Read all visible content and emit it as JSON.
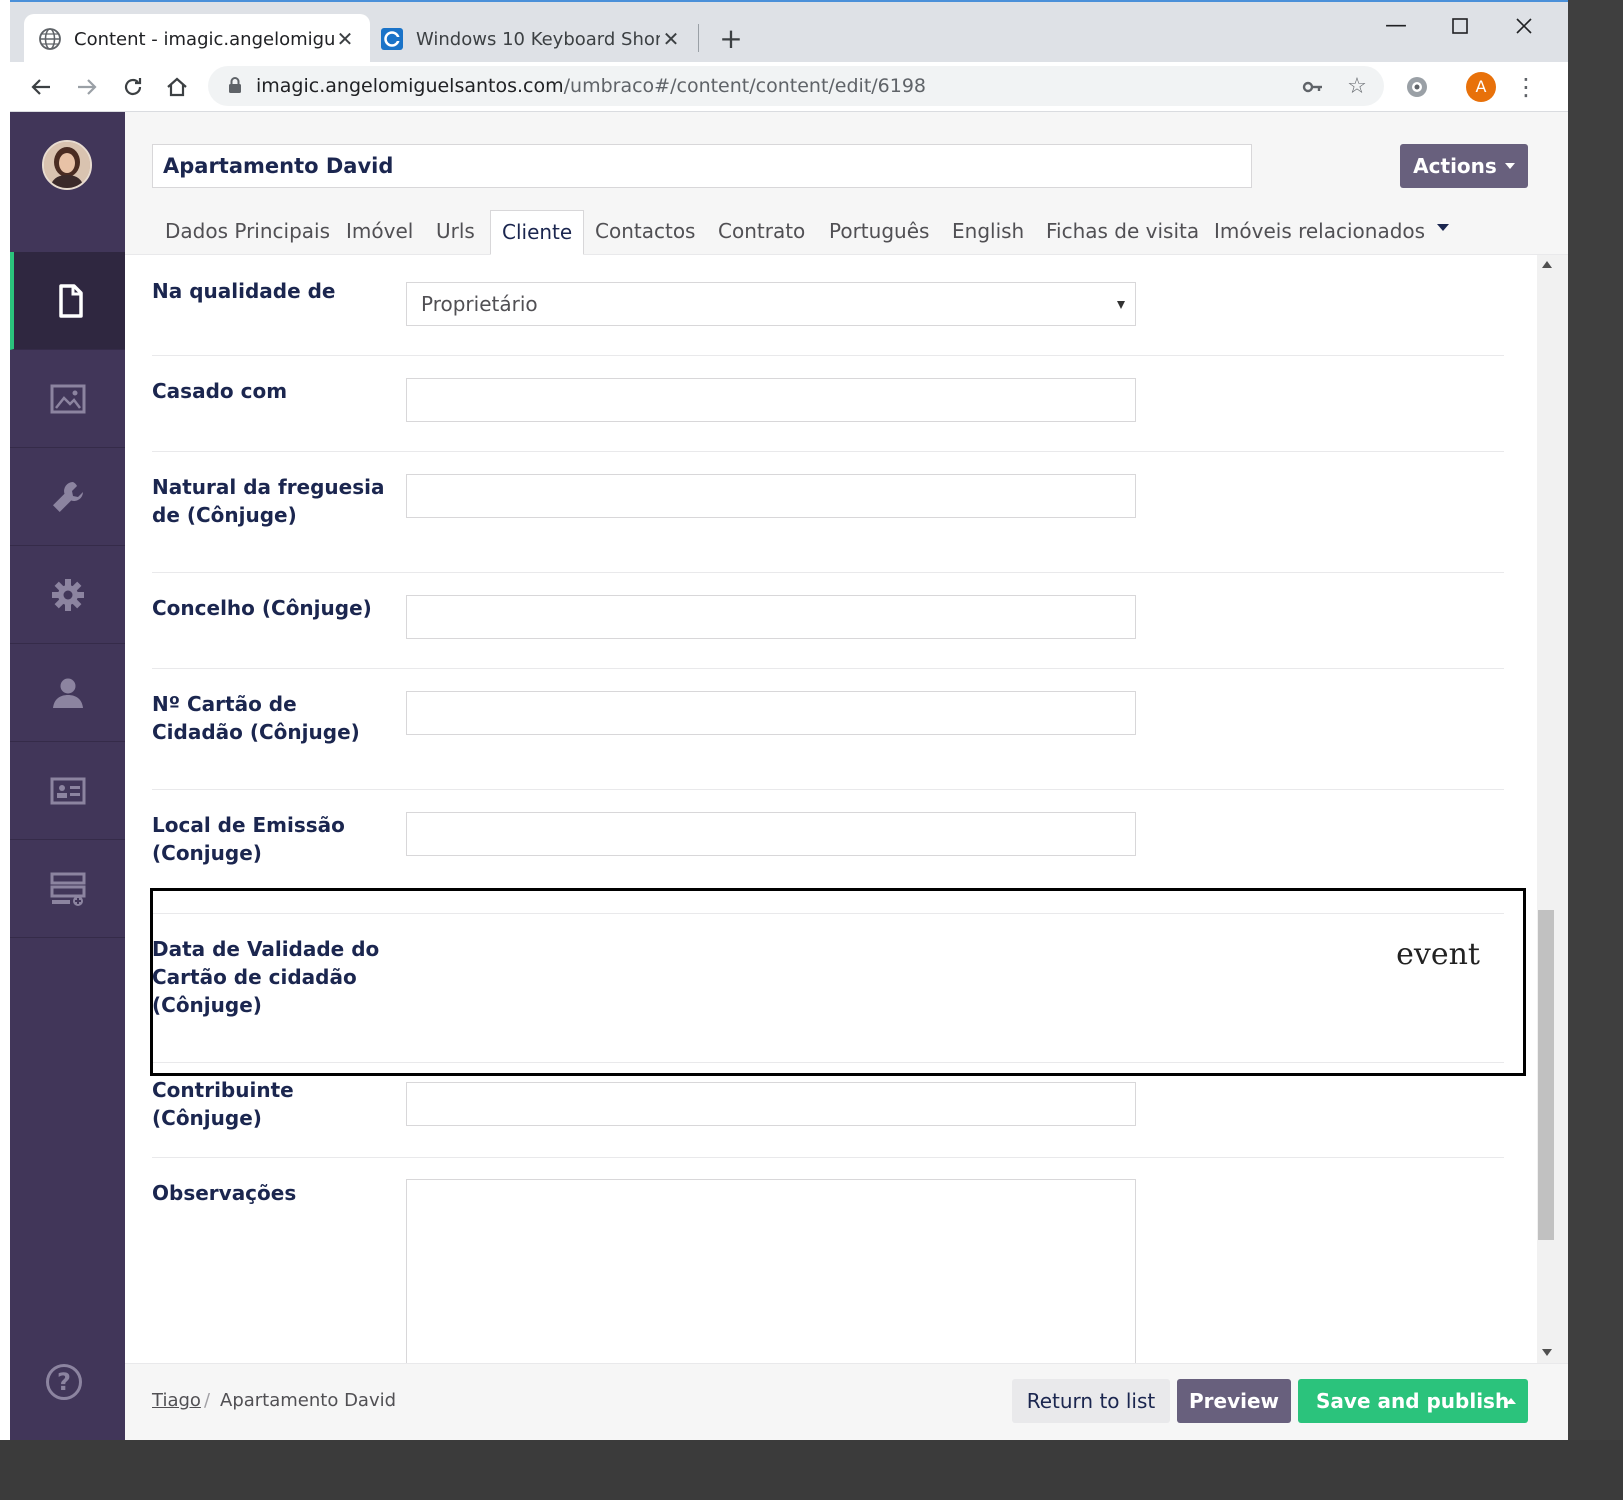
{
  "browser": {
    "tabs": [
      {
        "title": "Content - imagic.angelomiguelsantos.com",
        "active": true
      },
      {
        "title": "Windows 10 Keyboard Shortcuts",
        "active": false
      }
    ],
    "new_tab_symbol": "+",
    "close_symbol": "✕",
    "url_host": "imagic.angelomiguelsantos.com",
    "url_path": "/umbraco#/content/content/edit/6198",
    "profile_initial": "A",
    "icons": [
      "globe-icon",
      "tab-favicon-icon",
      "back-icon",
      "forward-icon",
      "reload-icon",
      "home-icon",
      "lock-icon",
      "key-icon",
      "star-icon",
      "extension-icon",
      "menu-icon",
      "minimize-icon",
      "maximize-icon",
      "close-icon"
    ]
  },
  "sidebar": {
    "sections": [
      "content",
      "media",
      "settings",
      "packages",
      "users",
      "members",
      "forms"
    ],
    "help_symbol": "?"
  },
  "editor": {
    "name": "Apartamento David",
    "actions_label": "Actions",
    "tabs": [
      "Dados Principais",
      "Imóvel",
      "Urls",
      "Cliente",
      "Contactos",
      "Contrato",
      "Português",
      "English",
      "Fichas de visita",
      "Imóveis relacionados"
    ],
    "active_tab": "Cliente"
  },
  "fields": {
    "qualidade": {
      "label": "Na qualidade de",
      "value": "Proprietário"
    },
    "casado": {
      "label": "Casado com",
      "value": ""
    },
    "natural": {
      "label": "Natural da freguesia de (Cônjuge)",
      "value": ""
    },
    "concelho": {
      "label": "Concelho (Cônjuge)",
      "value": ""
    },
    "cartao": {
      "label": "Nº Cartão de Cidadão (Cônjuge)",
      "value": ""
    },
    "emissao": {
      "label": "Local de Emissão (Conjuge)",
      "value": ""
    },
    "validade": {
      "label": "Data de Validade do Cartão de cidadão (Cônjuge)",
      "annotation": "event"
    },
    "contribuinte": {
      "label": "Contribuinte (Cônjuge)",
      "value": ""
    },
    "observacoes": {
      "label": "Observações",
      "value": ""
    }
  },
  "footer": {
    "crumb_parent": "Tiago",
    "crumb_sep": "/",
    "crumb_current": "Apartamento David",
    "return_label": "Return to list",
    "preview_label": "Preview",
    "publish_label": "Save and publish"
  },
  "colors": {
    "sidebar": "#413659",
    "accent_green": "#2bc37c",
    "button_purple": "#68607d",
    "text_navy": "#1b264f"
  }
}
